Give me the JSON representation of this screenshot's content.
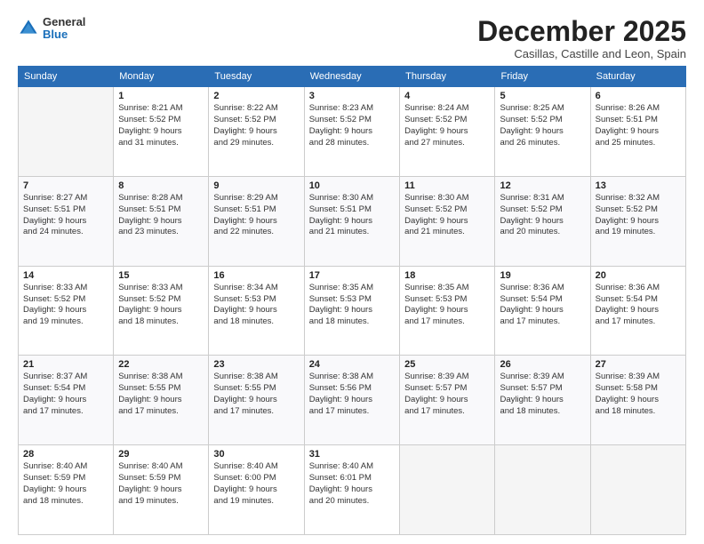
{
  "header": {
    "logo_general": "General",
    "logo_blue": "Blue",
    "month": "December 2025",
    "location": "Casillas, Castille and Leon, Spain"
  },
  "weekdays": [
    "Sunday",
    "Monday",
    "Tuesday",
    "Wednesday",
    "Thursday",
    "Friday",
    "Saturday"
  ],
  "weeks": [
    [
      {
        "day": "",
        "info": ""
      },
      {
        "day": "1",
        "info": "Sunrise: 8:21 AM\nSunset: 5:52 PM\nDaylight: 9 hours\nand 31 minutes."
      },
      {
        "day": "2",
        "info": "Sunrise: 8:22 AM\nSunset: 5:52 PM\nDaylight: 9 hours\nand 29 minutes."
      },
      {
        "day": "3",
        "info": "Sunrise: 8:23 AM\nSunset: 5:52 PM\nDaylight: 9 hours\nand 28 minutes."
      },
      {
        "day": "4",
        "info": "Sunrise: 8:24 AM\nSunset: 5:52 PM\nDaylight: 9 hours\nand 27 minutes."
      },
      {
        "day": "5",
        "info": "Sunrise: 8:25 AM\nSunset: 5:52 PM\nDaylight: 9 hours\nand 26 minutes."
      },
      {
        "day": "6",
        "info": "Sunrise: 8:26 AM\nSunset: 5:51 PM\nDaylight: 9 hours\nand 25 minutes."
      }
    ],
    [
      {
        "day": "7",
        "info": "Sunrise: 8:27 AM\nSunset: 5:51 PM\nDaylight: 9 hours\nand 24 minutes."
      },
      {
        "day": "8",
        "info": "Sunrise: 8:28 AM\nSunset: 5:51 PM\nDaylight: 9 hours\nand 23 minutes."
      },
      {
        "day": "9",
        "info": "Sunrise: 8:29 AM\nSunset: 5:51 PM\nDaylight: 9 hours\nand 22 minutes."
      },
      {
        "day": "10",
        "info": "Sunrise: 8:30 AM\nSunset: 5:51 PM\nDaylight: 9 hours\nand 21 minutes."
      },
      {
        "day": "11",
        "info": "Sunrise: 8:30 AM\nSunset: 5:52 PM\nDaylight: 9 hours\nand 21 minutes."
      },
      {
        "day": "12",
        "info": "Sunrise: 8:31 AM\nSunset: 5:52 PM\nDaylight: 9 hours\nand 20 minutes."
      },
      {
        "day": "13",
        "info": "Sunrise: 8:32 AM\nSunset: 5:52 PM\nDaylight: 9 hours\nand 19 minutes."
      }
    ],
    [
      {
        "day": "14",
        "info": "Sunrise: 8:33 AM\nSunset: 5:52 PM\nDaylight: 9 hours\nand 19 minutes."
      },
      {
        "day": "15",
        "info": "Sunrise: 8:33 AM\nSunset: 5:52 PM\nDaylight: 9 hours\nand 18 minutes."
      },
      {
        "day": "16",
        "info": "Sunrise: 8:34 AM\nSunset: 5:53 PM\nDaylight: 9 hours\nand 18 minutes."
      },
      {
        "day": "17",
        "info": "Sunrise: 8:35 AM\nSunset: 5:53 PM\nDaylight: 9 hours\nand 18 minutes."
      },
      {
        "day": "18",
        "info": "Sunrise: 8:35 AM\nSunset: 5:53 PM\nDaylight: 9 hours\nand 17 minutes."
      },
      {
        "day": "19",
        "info": "Sunrise: 8:36 AM\nSunset: 5:54 PM\nDaylight: 9 hours\nand 17 minutes."
      },
      {
        "day": "20",
        "info": "Sunrise: 8:36 AM\nSunset: 5:54 PM\nDaylight: 9 hours\nand 17 minutes."
      }
    ],
    [
      {
        "day": "21",
        "info": "Sunrise: 8:37 AM\nSunset: 5:54 PM\nDaylight: 9 hours\nand 17 minutes."
      },
      {
        "day": "22",
        "info": "Sunrise: 8:38 AM\nSunset: 5:55 PM\nDaylight: 9 hours\nand 17 minutes."
      },
      {
        "day": "23",
        "info": "Sunrise: 8:38 AM\nSunset: 5:55 PM\nDaylight: 9 hours\nand 17 minutes."
      },
      {
        "day": "24",
        "info": "Sunrise: 8:38 AM\nSunset: 5:56 PM\nDaylight: 9 hours\nand 17 minutes."
      },
      {
        "day": "25",
        "info": "Sunrise: 8:39 AM\nSunset: 5:57 PM\nDaylight: 9 hours\nand 17 minutes."
      },
      {
        "day": "26",
        "info": "Sunrise: 8:39 AM\nSunset: 5:57 PM\nDaylight: 9 hours\nand 18 minutes."
      },
      {
        "day": "27",
        "info": "Sunrise: 8:39 AM\nSunset: 5:58 PM\nDaylight: 9 hours\nand 18 minutes."
      }
    ],
    [
      {
        "day": "28",
        "info": "Sunrise: 8:40 AM\nSunset: 5:59 PM\nDaylight: 9 hours\nand 18 minutes."
      },
      {
        "day": "29",
        "info": "Sunrise: 8:40 AM\nSunset: 5:59 PM\nDaylight: 9 hours\nand 19 minutes."
      },
      {
        "day": "30",
        "info": "Sunrise: 8:40 AM\nSunset: 6:00 PM\nDaylight: 9 hours\nand 19 minutes."
      },
      {
        "day": "31",
        "info": "Sunrise: 8:40 AM\nSunset: 6:01 PM\nDaylight: 9 hours\nand 20 minutes."
      },
      {
        "day": "",
        "info": ""
      },
      {
        "day": "",
        "info": ""
      },
      {
        "day": "",
        "info": ""
      }
    ]
  ]
}
